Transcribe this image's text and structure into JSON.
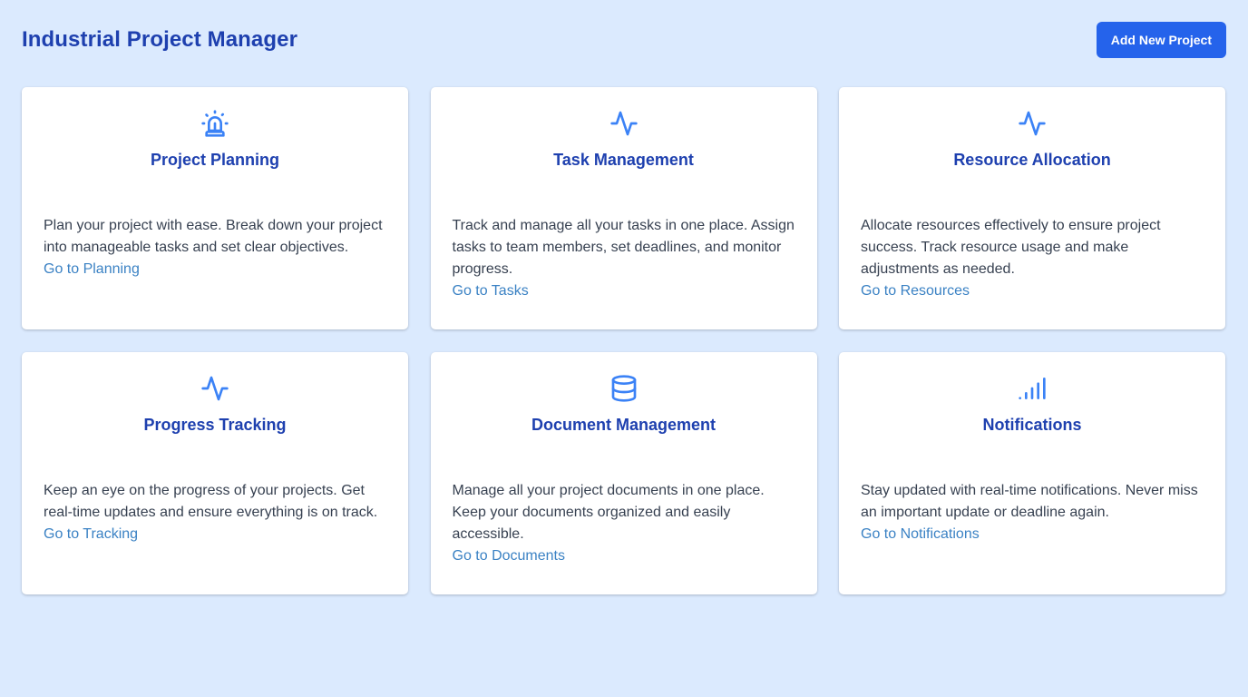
{
  "header": {
    "title": "Industrial Project Manager",
    "add_button_label": "Add New Project"
  },
  "colors": {
    "background": "#dbeafe",
    "accent": "#2563eb",
    "title": "#1e40af",
    "icon": "#3b82f6",
    "link": "#3b82c4"
  },
  "cards": [
    {
      "icon": "alarm-light-icon",
      "title": "Project Planning",
      "description": "Plan your project with ease. Break down your project into manageable tasks and set clear objectives.",
      "link": "Go to Planning"
    },
    {
      "icon": "activity-icon",
      "title": "Task Management",
      "description": "Track and manage all your tasks in one place. Assign tasks to team members, set deadlines, and monitor progress.",
      "link": "Go to Tasks"
    },
    {
      "icon": "activity-icon",
      "title": "Resource Allocation",
      "description": "Allocate resources effectively to ensure project success. Track resource usage and make adjustments as needed.",
      "link": "Go to Resources"
    },
    {
      "icon": "activity-icon",
      "title": "Progress Tracking",
      "description": "Keep an eye on the progress of your projects. Get real-time updates and ensure everything is on track.",
      "link": "Go to Tracking"
    },
    {
      "icon": "database-icon",
      "title": "Document Management",
      "description": "Manage all your project documents in one place. Keep your documents organized and easily accessible.",
      "link": "Go to Documents"
    },
    {
      "icon": "signal-icon",
      "title": "Notifications",
      "description": "Stay updated with real-time notifications. Never miss an important update or deadline again.",
      "link": "Go to Notifications"
    }
  ]
}
